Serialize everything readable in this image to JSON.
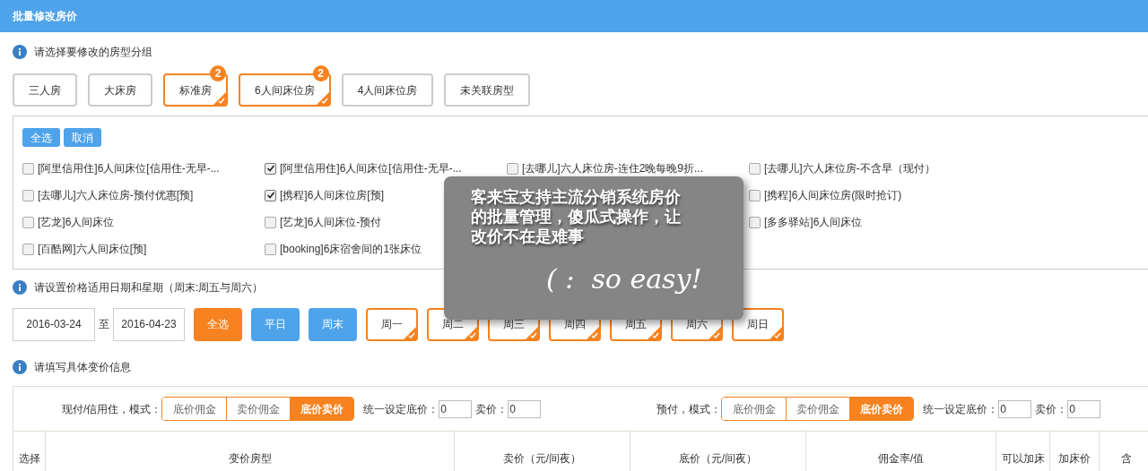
{
  "window": {
    "title": "批量修改房价"
  },
  "room_groups": {
    "heading": "请选择要修改的房型分组",
    "items": [
      {
        "label": "三人房",
        "selected": false
      },
      {
        "label": "大床房",
        "selected": false
      },
      {
        "label": "标准房",
        "selected": true,
        "badge": "2"
      },
      {
        "label": "6人间床位房",
        "selected": true,
        "badge": "2"
      },
      {
        "label": "4人间床位房",
        "selected": false
      },
      {
        "label": "未关联房型",
        "selected": false
      }
    ]
  },
  "room_options": {
    "select_all": "全选",
    "cancel": "取消",
    "rows": [
      [
        {
          "kind": "option",
          "label": "[阿里信用住]6人间床位[信用住-无早-...",
          "checked": false
        },
        {
          "kind": "option",
          "label": "[阿里信用住]6人间床位[信用住-无早-...",
          "checked": true
        },
        {
          "kind": "option",
          "label": "[去哪儿]六人床位房-连住2晚每晚9折...",
          "checked": false
        },
        {
          "kind": "option",
          "label": "[去哪儿]六人床位房-不含早（现付）",
          "checked": false
        }
      ],
      [
        {
          "kind": "option",
          "label": "[去哪儿]六人床位房-预付优惠[预]",
          "checked": false
        },
        {
          "kind": "option",
          "label": "[携程]6人间床位房[预]",
          "checked": true
        },
        {
          "kind": "covered"
        },
        {
          "kind": "option",
          "label": "[携程]6人间床位房(限时抢订)",
          "checked": false
        }
      ],
      [
        {
          "kind": "option",
          "label": "[艺龙]6人间床位",
          "checked": false
        },
        {
          "kind": "option",
          "label": "[艺龙]6人间床位-预付",
          "checked": false
        },
        {
          "kind": "covered"
        },
        {
          "kind": "option",
          "label": "[多多驿站]6人间床位",
          "checked": false
        }
      ],
      [
        {
          "kind": "option",
          "label": "[百酷网]六人间床位[预]",
          "checked": false
        },
        {
          "kind": "option",
          "label": "[booking]6床宿舍间的1张床位",
          "checked": false
        }
      ]
    ]
  },
  "dates": {
    "heading": "请设置价格适用日期和星期（周末:周五与周六）",
    "start": "2016-03-24",
    "separator": "至",
    "end": "2016-04-23",
    "quick": [
      {
        "label": "全选",
        "kind": "accent"
      },
      {
        "label": "平日",
        "kind": "plain"
      },
      {
        "label": "周末",
        "kind": "plain"
      }
    ],
    "weekdays": [
      {
        "label": "周一",
        "selected": true
      },
      {
        "label": "周二",
        "selected": true
      },
      {
        "label": "周三",
        "selected": true
      },
      {
        "label": "周四",
        "selected": true
      },
      {
        "label": "周五",
        "selected": true
      },
      {
        "label": "周六",
        "selected": true
      },
      {
        "label": "周日",
        "selected": true
      }
    ]
  },
  "price_info": {
    "heading": "请填写具体变价信息",
    "modes": [
      {
        "label": "现付/信用住，模式：",
        "options": [
          {
            "label": "底价佣金",
            "selected": false
          },
          {
            "label": "卖价佣金",
            "selected": false
          },
          {
            "label": "底价卖价",
            "selected": true
          }
        ],
        "base_label": "统一设定底价：",
        "base_value": "0",
        "sell_label": "卖价：",
        "sell_value": "0"
      },
      {
        "label": "预付，模式：",
        "options": [
          {
            "label": "底价佣金",
            "selected": false
          },
          {
            "label": "卖价佣金",
            "selected": false
          },
          {
            "label": "底价卖价",
            "selected": true
          }
        ],
        "base_label": "统一设定底价：",
        "base_value": "0",
        "sell_label": "卖价：",
        "sell_value": "0"
      }
    ],
    "columns": [
      "选择",
      "变价房型",
      "卖价（元/间夜）",
      "底价（元/间夜）",
      "佣金率/值",
      "可以加床",
      "加床价",
      "含"
    ]
  },
  "promo_overlay": {
    "text": "客来宝支持主流分销系统房价的批量管理，傻瓜式操作，让改价不在是难事",
    "tagline": "( :  so easy!"
  }
}
